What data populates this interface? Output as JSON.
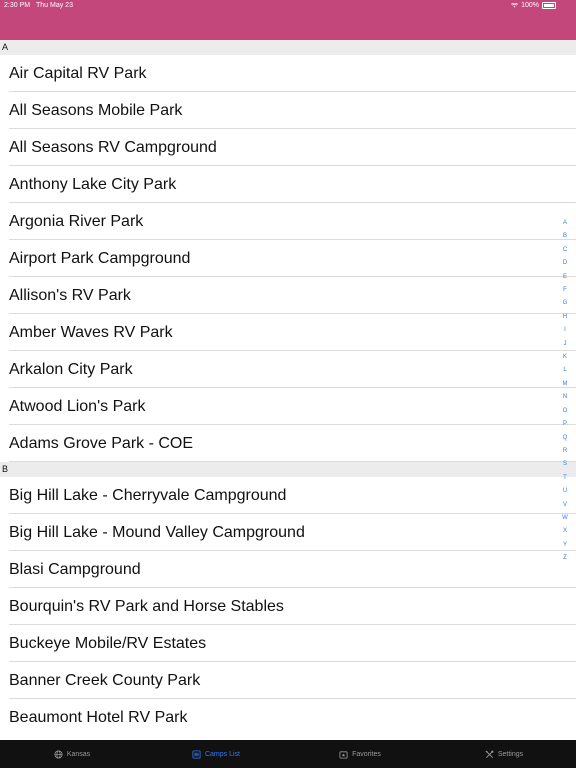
{
  "status_bar": {
    "time": "2:30 PM",
    "date": "Thu May 23",
    "battery": "100%"
  },
  "sections": [
    {
      "letter": "A",
      "items": [
        "Air Capital RV Park",
        "All Seasons Mobile Park",
        "All Seasons RV Campground",
        "Anthony Lake City Park",
        "Argonia River Park",
        "Airport Park Campground",
        "Allison's RV Park",
        "Amber Waves RV Park",
        "Arkalon City Park",
        "Atwood Lion's Park",
        "Adams Grove Park - COE"
      ]
    },
    {
      "letter": "B",
      "items": [
        "Big Hill Lake - Cherryvale Campground",
        "Big Hill Lake - Mound Valley Campground",
        "Blasi Campground",
        "Bourquin's RV Park and Horse Stables",
        "Buckeye Mobile/RV Estates",
        "Banner Creek County Park",
        "Beaumont Hotel RV Park"
      ]
    }
  ],
  "index_letters": [
    "A",
    "B",
    "C",
    "D",
    "E",
    "F",
    "G",
    "H",
    "I",
    "J",
    "K",
    "L",
    "M",
    "N",
    "O",
    "P",
    "Q",
    "R",
    "S",
    "T",
    "U",
    "V",
    "W",
    "X",
    "Y",
    "Z"
  ],
  "tabs": [
    {
      "label": "Kansas",
      "icon": "globe-icon",
      "active": false
    },
    {
      "label": "Camps List",
      "icon": "list-icon",
      "active": true
    },
    {
      "label": "Favorites",
      "icon": "favorites-icon",
      "active": false
    },
    {
      "label": "Settings",
      "icon": "tools-icon",
      "active": false
    }
  ],
  "colors": {
    "header": "#c4477c",
    "accent": "#3478f6",
    "tabbar": "#111111",
    "section_bg": "#ececec"
  }
}
